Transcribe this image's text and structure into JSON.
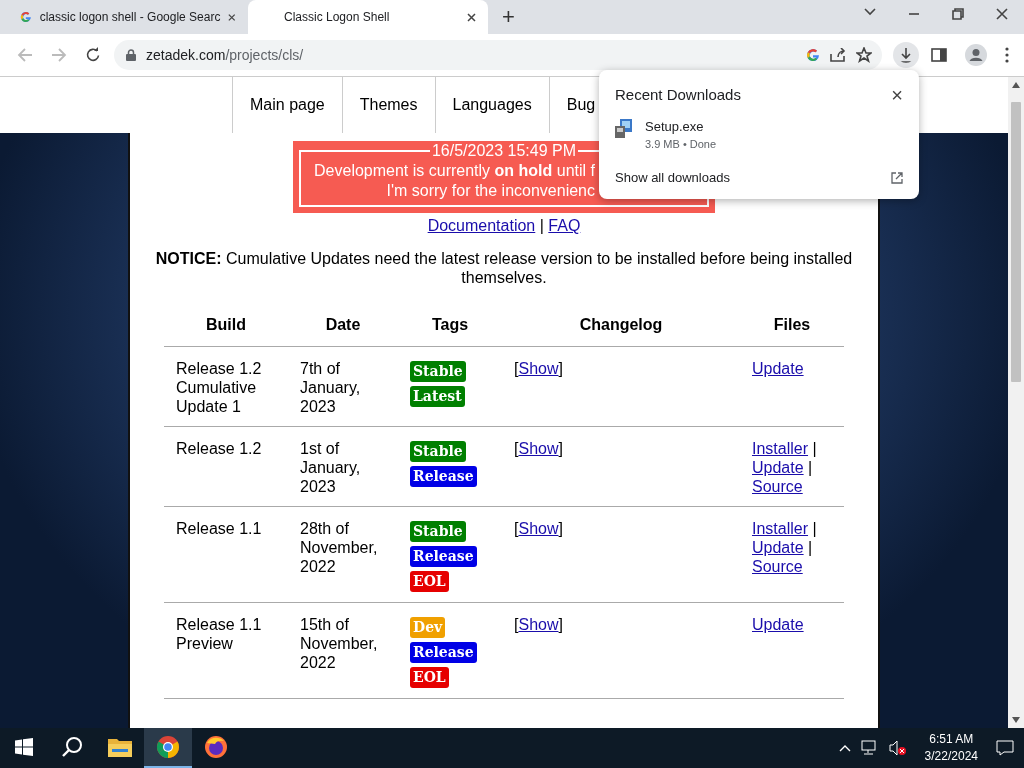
{
  "browser": {
    "tabs": [
      {
        "title": "classic logon shell - Google Searc",
        "selected": false
      },
      {
        "title": "Classic Logon Shell",
        "selected": true
      }
    ],
    "new_tab": "+",
    "url_host": "zetadek.com",
    "url_path": "/projects/cls/"
  },
  "nav": [
    {
      "label": "Main page"
    },
    {
      "label": "Themes"
    },
    {
      "label": "Languages"
    },
    {
      "label": "Bug"
    }
  ],
  "banner": {
    "legend": "16/5/2023 15:49 PM",
    "lines": [
      "Development is currently **on hold** until f",
      "I'm sorry for the inconvenienc"
    ]
  },
  "links": [
    {
      "label": "Documentation",
      "separator": "|"
    },
    {
      "label": "FAQ"
    }
  ],
  "notice": "**NOTICE:** Cumulative Updates need the latest release version to be installed before being installed themselves.",
  "table": {
    "columns": [
      "Build",
      "Date",
      "Tags",
      "Changelog",
      "Files"
    ],
    "rows": [
      {
        "build": "Release 1.2 Cumulative Update 1",
        "date": "7th of January, 2023",
        "tags": [
          {
            "label": "Stable",
            "color": "#008000"
          },
          {
            "label": "Latest",
            "color": "#008000"
          }
        ],
        "changelog": {
          "open": "[",
          "link": "Show",
          "close": "]"
        },
        "files": [
          {
            "label": "Update"
          }
        ]
      },
      {
        "build": "Release 1.2",
        "date": "1st of January, 2023",
        "tags": [
          {
            "label": "Stable",
            "color": "#008000"
          },
          {
            "label": "Release",
            "color": "#0000e6"
          }
        ],
        "changelog": {
          "open": "[",
          "link": "Show",
          "close": "]"
        },
        "files": [
          {
            "label": "Installer",
            "separator": "|"
          },
          {
            "label": "Update",
            "separator": "|"
          },
          {
            "label": "Source"
          }
        ]
      },
      {
        "build": "Release 1.1",
        "date": "28th of November, 2022",
        "tags": [
          {
            "label": "Stable",
            "color": "#008000"
          },
          {
            "label": "Release",
            "color": "#0000e6"
          },
          {
            "label": "EOL",
            "color": "#e60000"
          }
        ],
        "changelog": {
          "open": "[",
          "link": "Show",
          "close": "]"
        },
        "files": [
          {
            "label": "Installer",
            "separator": "|"
          },
          {
            "label": "Update",
            "separator": "|"
          },
          {
            "label": "Source"
          }
        ]
      },
      {
        "build": "Release 1.1 Preview",
        "date": "15th of November, 2022",
        "tags": [
          {
            "label": "Dev",
            "color": "#f0a000"
          },
          {
            "label": "Release",
            "color": "#0000e6"
          },
          {
            "label": "EOL",
            "color": "#e60000"
          }
        ],
        "changelog": {
          "open": "[",
          "link": "Show",
          "close": "]"
        },
        "files": [
          {
            "label": "Update"
          }
        ]
      }
    ]
  },
  "downloads": {
    "title": "Recent Downloads",
    "close": "×",
    "items": [
      {
        "name": "Setup.exe",
        "status": "3.9 MB • Done"
      }
    ],
    "show_all": "Show all downloads"
  },
  "taskbar": {
    "apps": [
      {
        "kind": "search",
        "selected": false
      },
      {
        "kind": "folder",
        "selected": false
      },
      {
        "kind": "chrome",
        "selected": true
      },
      {
        "kind": "firefox",
        "selected": false
      }
    ],
    "time": "6:51 AM",
    "date": "3/22/2024"
  }
}
